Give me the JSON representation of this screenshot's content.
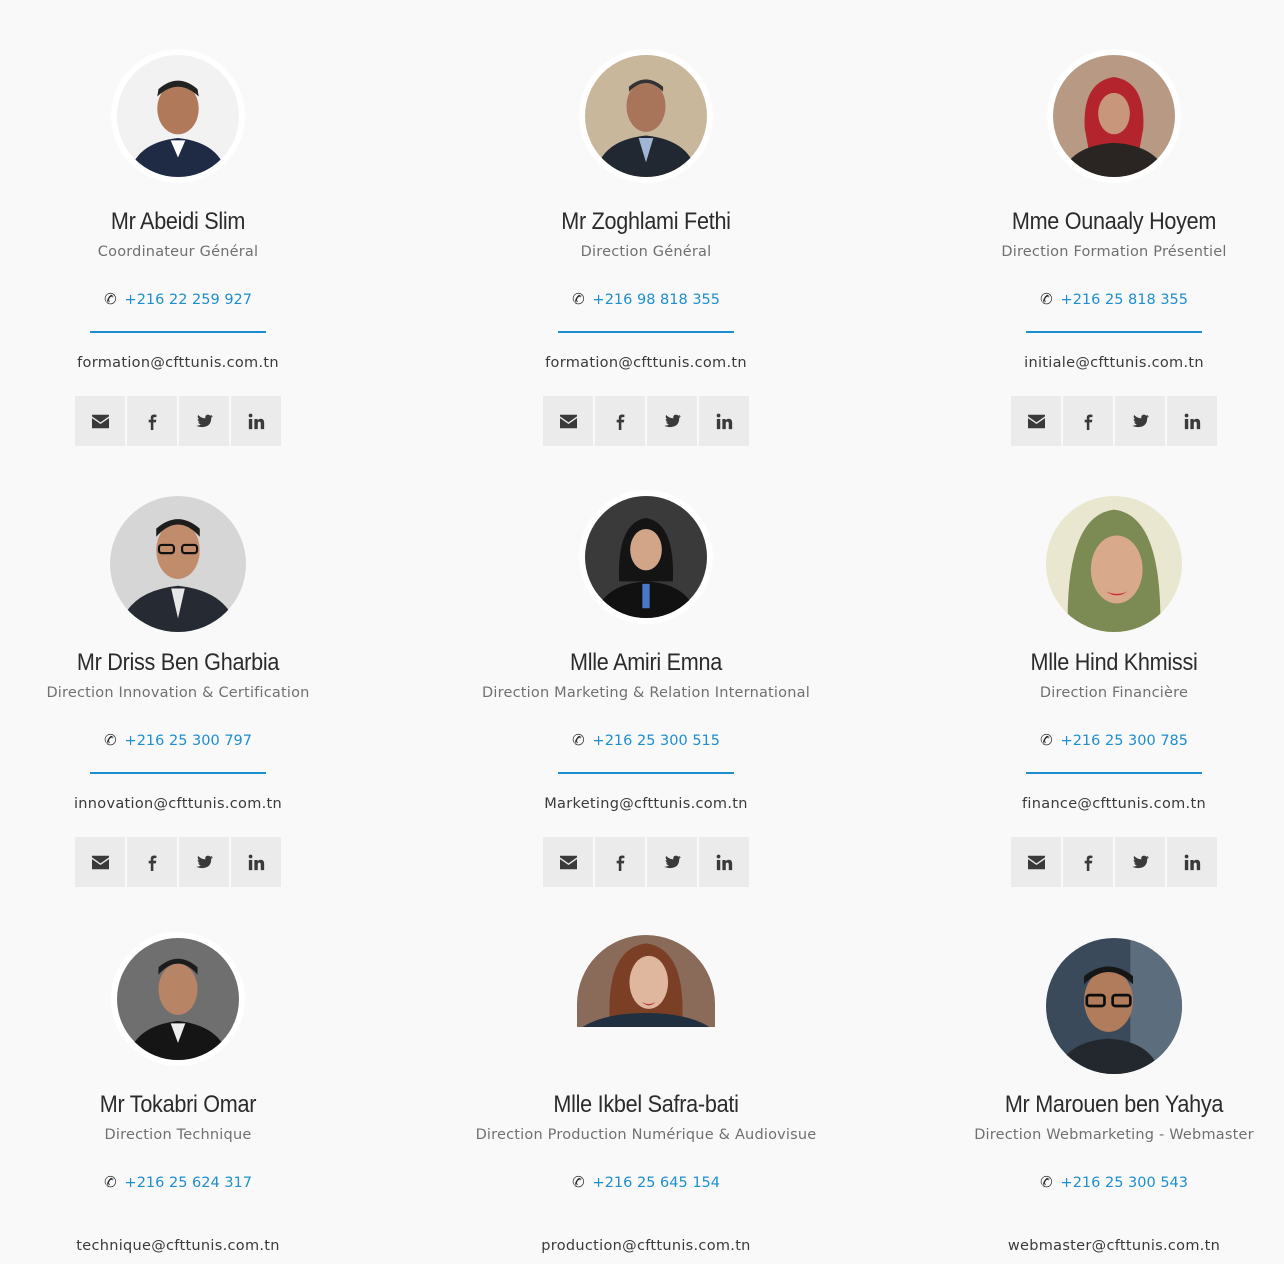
{
  "team": [
    {
      "name": "Mr Abeidi Slim",
      "role": "Coordinateur Général",
      "phone": "+216 22 259 927",
      "email": "formation@cfttunis.com.tn"
    },
    {
      "name": "Mr Zoghlami Fethi",
      "role": "Direction Général",
      "phone": "+216 98 818 355",
      "email": "formation@cfttunis.com.tn"
    },
    {
      "name": "Mme Ounaaly Hoyem",
      "role": "Direction Formation Présentiel",
      "phone": "+216 25 818 355",
      "email": "initiale@cfttunis.com.tn"
    },
    {
      "name": "Mr Driss Ben Gharbia",
      "role": "Direction Innovation & Certification",
      "phone": "+216 25 300 797",
      "email": "innovation@cfttunis.com.tn"
    },
    {
      "name": "Mlle Amiri Emna",
      "role": "Direction Marketing & Relation International",
      "phone": "+216 25 300 515",
      "email": "Marketing@cfttunis.com.tn"
    },
    {
      "name": "Mlle Hind Khmissi",
      "role": "Direction Financière",
      "phone": "+216 25 300 785",
      "email": "finance@cfttunis.com.tn"
    },
    {
      "name": "Mr Tokabri Omar",
      "role": "Direction Technique",
      "phone": "+216 25 624 317",
      "email": "technique@cfttunis.com.tn"
    },
    {
      "name": "Mlle Ikbel Safra-bati",
      "role": "Direction Production Numérique & Audiovisue",
      "phone": "+216 25 645 154",
      "email": "production@cfttunis.com.tn"
    },
    {
      "name": "Mr Marouen ben Yahya",
      "role": "Direction Webmarketing - Webmaster",
      "phone": "+216 25 300 543",
      "email": "webmaster@cfttunis.com.tn"
    }
  ],
  "icons": {
    "phone": "phone-icon",
    "mail": "envelope-icon",
    "facebook": "facebook-icon",
    "twitter": "twitter-icon",
    "linkedin": "linkedin-icon"
  },
  "colors": {
    "accent": "#1d8ecf",
    "background": "#f9f9f9",
    "social_bg": "#ebebeb"
  }
}
